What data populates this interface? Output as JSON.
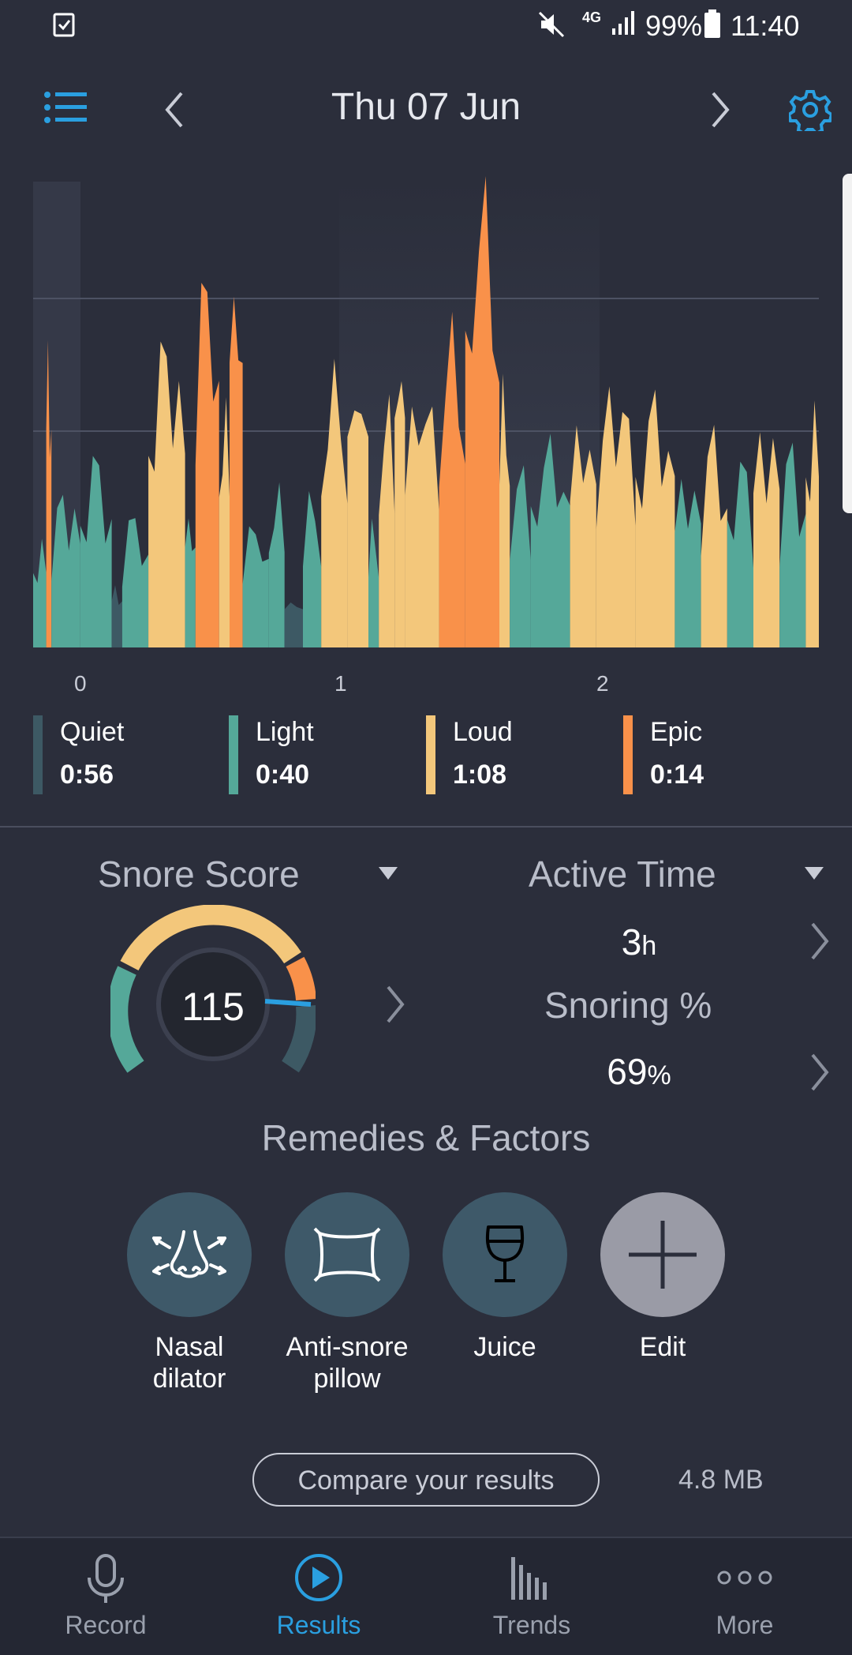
{
  "status_bar": {
    "battery": "99%",
    "time": "11:40",
    "network": "4G"
  },
  "header": {
    "date": "Thu 07 Jun",
    "menu_icon": "list-icon",
    "prev_icon": "chevron-left-icon",
    "next_icon": "chevron-right-icon",
    "settings_icon": "gear-icon"
  },
  "chart_data": {
    "type": "area",
    "x_tick_labels": [
      "0",
      "1",
      "2"
    ],
    "xlabel": "",
    "ylabel": "",
    "grid": true,
    "categories": [
      "Quiet",
      "Light",
      "Loud",
      "Epic"
    ],
    "colors": {
      "Quiet": "#3d5964",
      "Light": "#55a899",
      "Loud": "#f3c77b",
      "Epic": "#f9914a"
    },
    "segments": [
      {
        "start": 0.0,
        "end": 0.05,
        "level": "Light",
        "peak": 0.25
      },
      {
        "start": 0.05,
        "end": 0.07,
        "level": "Epic",
        "peak": 0.72
      },
      {
        "start": 0.07,
        "end": 0.18,
        "level": "Light",
        "peak": 0.35
      },
      {
        "start": 0.18,
        "end": 0.3,
        "level": "Light",
        "peak": 0.42
      },
      {
        "start": 0.3,
        "end": 0.34,
        "level": "Quiet",
        "peak": 0.15
      },
      {
        "start": 0.34,
        "end": 0.44,
        "level": "Light",
        "peak": 0.3
      },
      {
        "start": 0.44,
        "end": 0.58,
        "level": "Loud",
        "peak": 0.68
      },
      {
        "start": 0.58,
        "end": 0.62,
        "level": "Light",
        "peak": 0.32
      },
      {
        "start": 0.62,
        "end": 0.71,
        "level": "Epic",
        "peak": 0.85
      },
      {
        "start": 0.71,
        "end": 0.75,
        "level": "Loud",
        "peak": 0.55
      },
      {
        "start": 0.75,
        "end": 0.8,
        "level": "Epic",
        "peak": 0.9
      },
      {
        "start": 0.8,
        "end": 0.9,
        "level": "Light",
        "peak": 0.28
      },
      {
        "start": 0.9,
        "end": 0.96,
        "level": "Light",
        "peak": 0.36
      },
      {
        "start": 0.96,
        "end": 1.03,
        "level": "Quiet",
        "peak": 0.12
      },
      {
        "start": 1.03,
        "end": 1.1,
        "level": "Light",
        "peak": 0.34
      },
      {
        "start": 1.1,
        "end": 1.2,
        "level": "Loud",
        "peak": 0.6
      },
      {
        "start": 1.2,
        "end": 1.28,
        "level": "Loud",
        "peak": 0.66
      },
      {
        "start": 1.28,
        "end": 1.32,
        "level": "Light",
        "peak": 0.28
      },
      {
        "start": 1.32,
        "end": 1.38,
        "level": "Loud",
        "peak": 0.55
      },
      {
        "start": 1.38,
        "end": 1.42,
        "level": "Loud",
        "peak": 0.72
      },
      {
        "start": 1.42,
        "end": 1.55,
        "level": "Loud",
        "peak": 0.58
      },
      {
        "start": 1.55,
        "end": 1.65,
        "level": "Epic",
        "peak": 0.7
      },
      {
        "start": 1.65,
        "end": 1.78,
        "level": "Epic",
        "peak": 1.0
      },
      {
        "start": 1.78,
        "end": 1.82,
        "level": "Loud",
        "peak": 0.6
      },
      {
        "start": 1.82,
        "end": 1.9,
        "level": "Light",
        "peak": 0.4
      },
      {
        "start": 1.9,
        "end": 2.05,
        "level": "Light",
        "peak": 0.45
      },
      {
        "start": 2.05,
        "end": 2.15,
        "level": "Loud",
        "peak": 0.52
      },
      {
        "start": 2.15,
        "end": 2.3,
        "level": "Loud",
        "peak": 0.58
      },
      {
        "start": 2.3,
        "end": 2.45,
        "level": "Loud",
        "peak": 0.55
      },
      {
        "start": 2.45,
        "end": 2.55,
        "level": "Light",
        "peak": 0.4
      },
      {
        "start": 2.55,
        "end": 2.65,
        "level": "Loud",
        "peak": 0.48
      },
      {
        "start": 2.65,
        "end": 2.75,
        "level": "Light",
        "peak": 0.42
      },
      {
        "start": 2.75,
        "end": 2.85,
        "level": "Loud",
        "peak": 0.52
      },
      {
        "start": 2.85,
        "end": 2.95,
        "level": "Light",
        "peak": 0.45
      },
      {
        "start": 2.95,
        "end": 3.0,
        "level": "Loud",
        "peak": 0.57
      }
    ],
    "xlim": [
      0,
      3
    ],
    "ylim": [
      0,
      1
    ]
  },
  "legend": [
    {
      "name": "Quiet",
      "value": "0:56",
      "color": "#3d5964"
    },
    {
      "name": "Light",
      "value": "0:40",
      "color": "#55a899"
    },
    {
      "name": "Loud",
      "value": "1:08",
      "color": "#f3c77b"
    },
    {
      "name": "Epic",
      "value": "0:14",
      "color": "#f9914a"
    }
  ],
  "snore_score": {
    "title": "Snore Score",
    "value": "115",
    "dropdown_icon": "caret-down-icon",
    "arrow_icon": "chevron-right-icon"
  },
  "active_time": {
    "title": "Active Time",
    "value": "3",
    "unit": "h"
  },
  "snoring_pct": {
    "title": "Snoring %",
    "value": "69",
    "unit": "%"
  },
  "remedies": {
    "title": "Remedies & Factors",
    "items": [
      {
        "label_line1": "Nasal",
        "label_line2": "dilator",
        "icon": "nose-icon"
      },
      {
        "label_line1": "Anti-snore",
        "label_line2": "pillow",
        "icon": "pillow-icon"
      },
      {
        "label_line1": "Juice",
        "label_line2": "",
        "icon": "glass-icon"
      },
      {
        "label_line1": "Edit",
        "label_line2": "",
        "icon": "plus-icon"
      }
    ]
  },
  "compare_button": "Compare your results",
  "file_size": "4.8 MB",
  "nav": [
    {
      "label": "Record",
      "icon": "microphone-icon"
    },
    {
      "label": "Results",
      "icon": "play-icon"
    },
    {
      "label": "Trends",
      "icon": "bar-chart-icon"
    },
    {
      "label": "More",
      "icon": "more-dots-icon"
    }
  ],
  "colors": {
    "accent": "#2a9fe0",
    "background": "#2b2e3b",
    "nav_inactive": "#9aa0ad"
  }
}
